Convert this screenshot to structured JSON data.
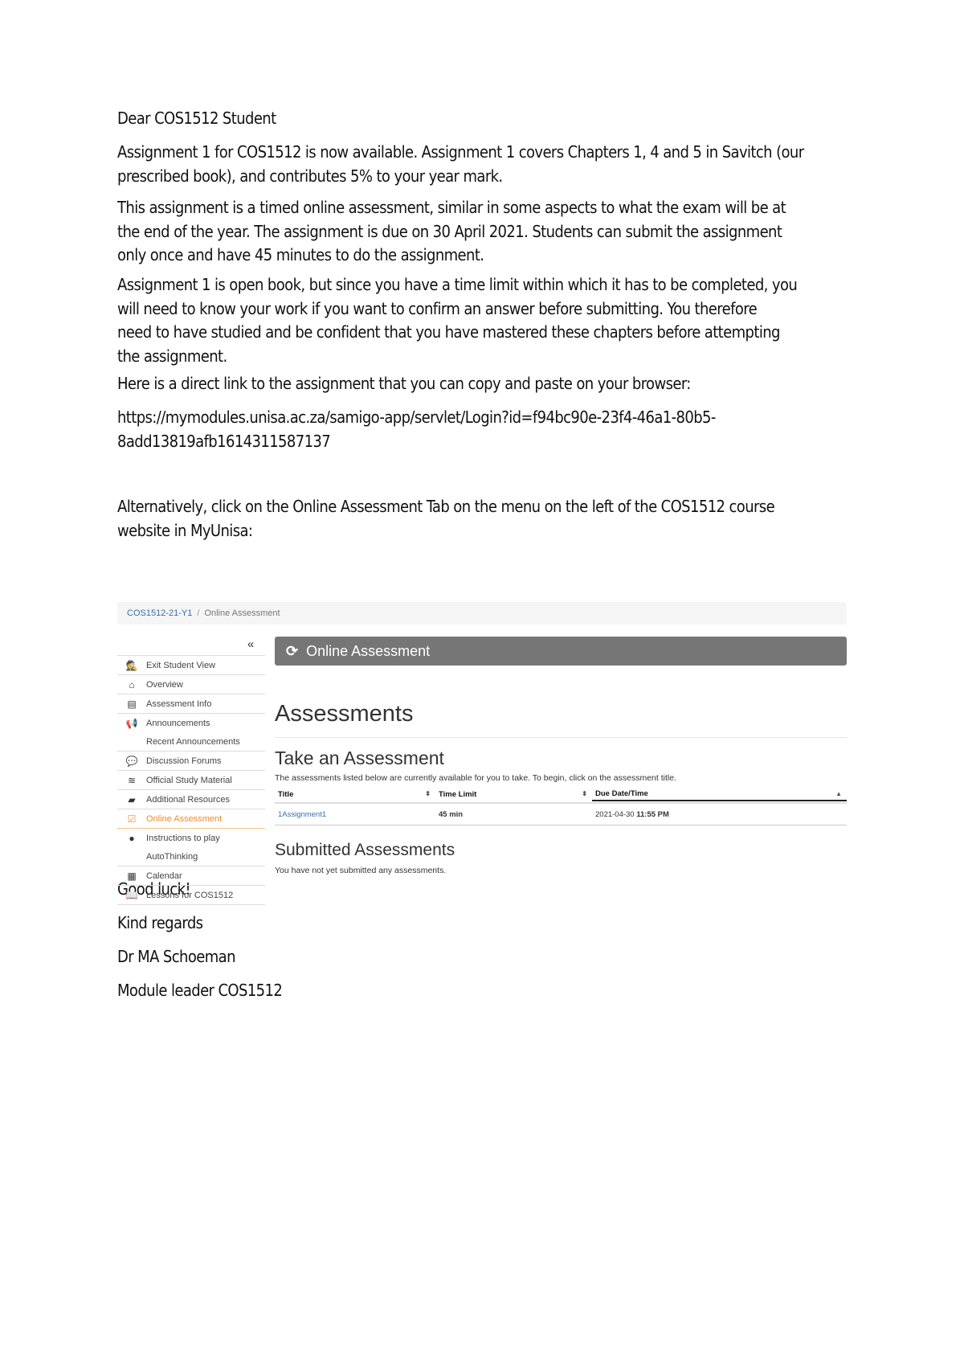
{
  "letter": {
    "greeting": "Dear COS1512 Student",
    "para1": [
      "Assignment 1 for COS1512 is now available. Assignment 1 covers Chapters 1, 4 and 5 in Savitch (our",
      "prescribed book), and contributes 5% to your year mark."
    ],
    "para2": [
      "This assignment is a timed online assessment, similar in some aspects to what the exam will be at",
      "the end of the year. The assignment is due on 30 April 2021. Students can submit the assignment",
      "only once and have 45 minutes to do the assignment."
    ],
    "para3": [
      "Assignment 1 is open book, but since you have a time limit within which it has to be completed, you",
      "will need to know your work if you want to confirm an answer before submitting.  You therefore",
      "need to have studied and be confident that you have mastered these chapters before attempting",
      "the assignment."
    ],
    "para4": "Here is a direct link to the assignment that you can copy and paste on your browser:",
    "link": [
      "https://mymodules.unisa.ac.za/samigo-app/servlet/Login?id=f94bc90e-23f4-46a1-80b5-",
      "8add13819afb1614311587137"
    ],
    "para5": [
      "Alternatively, click on the Online Assessment Tab on the menu on the left of the COS1512 course",
      "website in MyUnisa:"
    ],
    "closing": [
      "Good luck!",
      "Kind regards",
      "Dr MA Schoeman",
      "Module leader COS1512"
    ]
  },
  "screenshot": {
    "breadcrumb": {
      "course": "COS1512-21-Y1",
      "separator": "/",
      "current": "Online Assessment"
    },
    "collapse_glyph": "«",
    "nav": [
      {
        "label": "Exit Student View",
        "icon": "user-secret-icon",
        "glyph": "🕵"
      },
      {
        "label": "Overview",
        "icon": "home-icon",
        "glyph": "⌂"
      },
      {
        "label": "Assessment Info",
        "icon": "file-icon",
        "glyph": "▤"
      },
      {
        "label": "Announcements",
        "icon": "bullhorn-icon",
        "glyph": "📢"
      },
      {
        "label": "Recent Announcements",
        "icon": "",
        "glyph": ""
      },
      {
        "label": "Discussion Forums",
        "icon": "comments-icon",
        "glyph": "💬"
      },
      {
        "label": "Official Study Material",
        "icon": "stack-icon",
        "glyph": "≋"
      },
      {
        "label": "Additional Resources",
        "icon": "folder-open-icon",
        "glyph": "▰"
      },
      {
        "label": "Online Assessment",
        "icon": "check-square-icon",
        "glyph": "☑",
        "active": true
      },
      {
        "label": "Instructions to play",
        "icon": "globe-icon",
        "glyph": "●"
      },
      {
        "label": "AutoThinking",
        "icon": "",
        "glyph": ""
      },
      {
        "label": "Calendar",
        "icon": "calendar-icon",
        "glyph": "▦"
      },
      {
        "label": "Lessons for COS1512",
        "icon": "book-icon",
        "glyph": "📖"
      }
    ],
    "banner": {
      "title": "Online Assessment",
      "icon_glyph": "⟳"
    },
    "heading": "Assessments",
    "take": {
      "heading": "Take an Assessment",
      "description": "The assessments listed below are currently available for you to take. To begin, click on the assessment title.",
      "columns": [
        "Title",
        "Time Limit",
        "Due Date/Time"
      ],
      "rows": [
        {
          "title": "1Assignment1",
          "time_limit": "45 min",
          "due_date": "2021-04-30",
          "due_time": "11:55 PM"
        }
      ]
    },
    "submitted": {
      "heading": "Submitted Assessments",
      "message": "You have not yet submitted any assessments."
    }
  }
}
